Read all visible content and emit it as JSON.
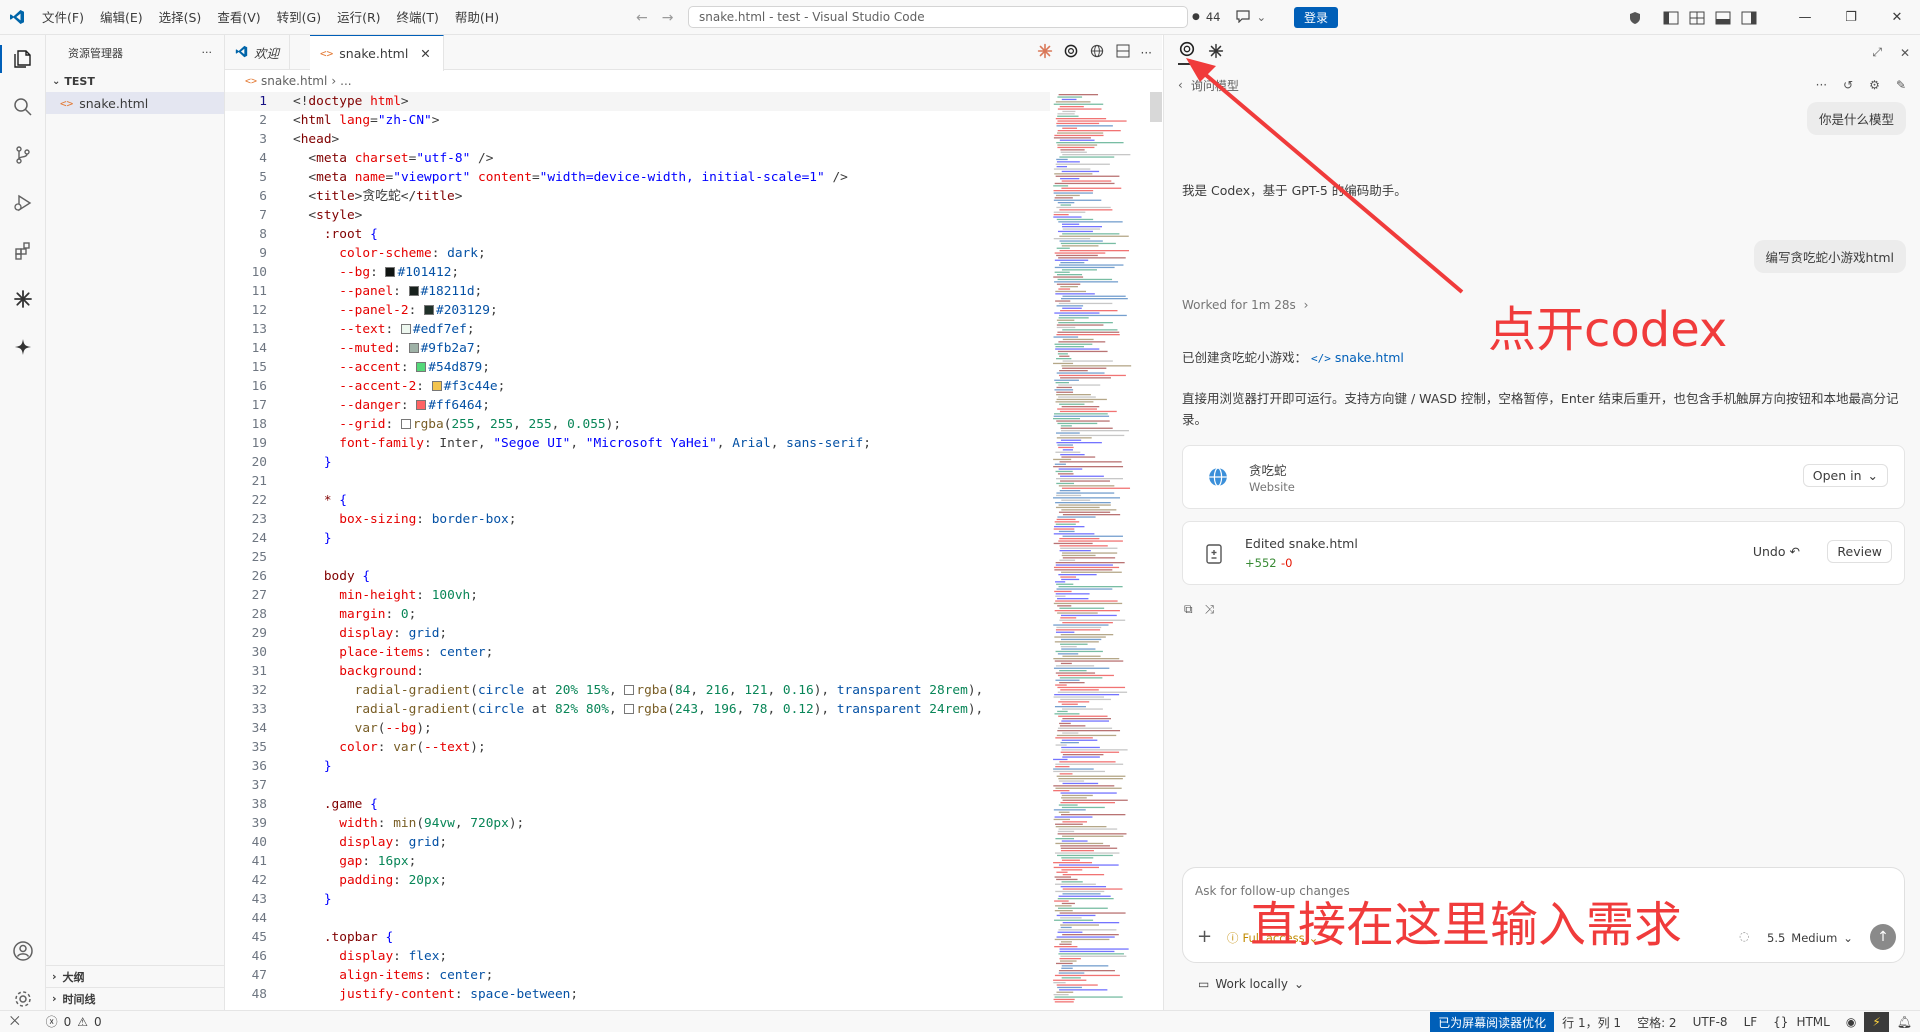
{
  "titlebar": {
    "menu": [
      "文件(F)",
      "编辑(E)",
      "选择(S)",
      "查看(V)",
      "转到(G)",
      "运行(R)",
      "终端(T)",
      "帮助(H)"
    ],
    "window_title": "snake.html - test - Visual Studio Code",
    "count": "44",
    "login_label": "登录",
    "window_buttons": [
      "—",
      "❐",
      "✕"
    ]
  },
  "sidebar": {
    "title": "资源管理器",
    "more": "···",
    "folder": "TEST",
    "file": "snake.html",
    "outline": "大纲",
    "timeline": "时间线"
  },
  "editor": {
    "tabs": [
      {
        "label": "欢迎",
        "active": false
      },
      {
        "label": "snake.html",
        "active": true
      }
    ],
    "breadcrumb": [
      "snake.html",
      "..."
    ],
    "lines": [
      {
        "n": "1",
        "html": "<span class='tok-punc'>&lt;!</span><span class='tok-tag'>doctype</span> <span class='tok-attr'>html</span><span class='tok-punc'>&gt;</span>"
      },
      {
        "n": "2",
        "html": "<span class='tok-punc'>&lt;</span><span class='tok-tag'>html</span> <span class='tok-attr'>lang</span>=<span class='tok-str'>\"zh-CN\"</span><span class='tok-punc'>&gt;</span>"
      },
      {
        "n": "3",
        "html": "<span class='tok-punc'>&lt;</span><span class='tok-tag'>head</span><span class='tok-punc'>&gt;</span>"
      },
      {
        "n": "4",
        "html": "  <span class='tok-punc'>&lt;</span><span class='tok-tag'>meta</span> <span class='tok-attr'>charset</span>=<span class='tok-str'>\"utf-8\"</span> <span class='tok-punc'>/&gt;</span>"
      },
      {
        "n": "5",
        "html": "  <span class='tok-punc'>&lt;</span><span class='tok-tag'>meta</span> <span class='tok-attr'>name</span>=<span class='tok-str'>\"viewport\"</span> <span class='tok-attr'>content</span>=<span class='tok-str'>\"width=device-width, initial-scale=1\"</span> <span class='tok-punc'>/&gt;</span>"
      },
      {
        "n": "6",
        "html": "  <span class='tok-punc'>&lt;</span><span class='tok-tag'>title</span><span class='tok-punc'>&gt;</span>贪吃蛇<span class='tok-punc'>&lt;/</span><span class='tok-tag'>title</span><span class='tok-punc'>&gt;</span>"
      },
      {
        "n": "7",
        "html": "  <span class='tok-punc'>&lt;</span><span class='tok-tag'>style</span><span class='tok-punc'>&gt;</span>"
      },
      {
        "n": "8",
        "html": "    <span class='tok-sel'>:root</span> <span class='tok-kw'>{</span>"
      },
      {
        "n": "9",
        "html": "      <span class='tok-prop'>color-scheme</span>: <span class='tok-val'>dark</span>;"
      },
      {
        "n": "10",
        "html": "      <span class='tok-prop'>--bg</span>: <span class='swatch' style='background:#101412'></span><span class='tok-val'>#101412</span>;"
      },
      {
        "n": "11",
        "html": "      <span class='tok-prop'>--panel</span>: <span class='swatch' style='background:#18211d'></span><span class='tok-val'>#18211d</span>;"
      },
      {
        "n": "12",
        "html": "      <span class='tok-prop'>--panel-2</span>: <span class='swatch' style='background:#203129'></span><span class='tok-val'>#203129</span>;"
      },
      {
        "n": "13",
        "html": "      <span class='tok-prop'>--text</span>: <span class='swatch' style='background:#edf7ef'></span><span class='tok-val'>#edf7ef</span>;"
      },
      {
        "n": "14",
        "html": "      <span class='tok-prop'>--muted</span>: <span class='swatch' style='background:#9fb2a7'></span><span class='tok-val'>#9fb2a7</span>;"
      },
      {
        "n": "15",
        "html": "      <span class='tok-prop'>--accent</span>: <span class='swatch' style='background:#54d879'></span><span class='tok-val'>#54d879</span>;"
      },
      {
        "n": "16",
        "html": "      <span class='tok-prop'>--accent-2</span>: <span class='swatch' style='background:#f3c44e'></span><span class='tok-val'>#f3c44e</span>;"
      },
      {
        "n": "17",
        "html": "      <span class='tok-prop'>--danger</span>: <span class='swatch' style='background:#ff6464'></span><span class='tok-val'>#ff6464</span>;"
      },
      {
        "n": "18",
        "html": "      <span class='tok-prop'>--grid</span>: <span class='swatch' style='background:#ffffff'></span><span class='tok-fn'>rgba</span>(<span class='tok-num'>255</span>, <span class='tok-num'>255</span>, <span class='tok-num'>255</span>, <span class='tok-num'>0.055</span>);"
      },
      {
        "n": "19",
        "html": "      <span class='tok-prop'>font-family</span>: Inter, <span class='tok-str'>\"Segoe UI\"</span>, <span class='tok-str'>\"Microsoft YaHei\"</span>, <span class='tok-val'>Arial</span>, <span class='tok-val'>sans-serif</span>;"
      },
      {
        "n": "20",
        "html": "    <span class='tok-kw'>}</span>"
      },
      {
        "n": "21",
        "html": ""
      },
      {
        "n": "22",
        "html": "    <span class='tok-sel'>*</span> <span class='tok-kw'>{</span>"
      },
      {
        "n": "23",
        "html": "      <span class='tok-prop'>box-sizing</span>: <span class='tok-val'>border-box</span>;"
      },
      {
        "n": "24",
        "html": "    <span class='tok-kw'>}</span>"
      },
      {
        "n": "25",
        "html": ""
      },
      {
        "n": "26",
        "html": "    <span class='tok-sel'>body</span> <span class='tok-kw'>{</span>"
      },
      {
        "n": "27",
        "html": "      <span class='tok-prop'>min-height</span>: <span class='tok-num'>100vh</span>;"
      },
      {
        "n": "28",
        "html": "      <span class='tok-prop'>margin</span>: <span class='tok-num'>0</span>;"
      },
      {
        "n": "29",
        "html": "      <span class='tok-prop'>display</span>: <span class='tok-val'>grid</span>;"
      },
      {
        "n": "30",
        "html": "      <span class='tok-prop'>place-items</span>: <span class='tok-val'>center</span>;"
      },
      {
        "n": "31",
        "html": "      <span class='tok-prop'>background</span>:"
      },
      {
        "n": "32",
        "html": "        <span class='tok-fn'>radial-gradient</span>(<span class='tok-val'>circle</span> at <span class='tok-num'>20%</span> <span class='tok-num'>15%</span>, <span class='swatch' style='background:#fff'></span><span class='tok-fn'>rgba</span>(<span class='tok-num'>84</span>, <span class='tok-num'>216</span>, <span class='tok-num'>121</span>, <span class='tok-num'>0.16</span>), <span class='tok-val'>transparent</span> <span class='tok-num'>28rem</span>),"
      },
      {
        "n": "33",
        "html": "        <span class='tok-fn'>radial-gradient</span>(<span class='tok-val'>circle</span> at <span class='tok-num'>82%</span> <span class='tok-num'>80%</span>, <span class='swatch' style='background:#fff'></span><span class='tok-fn'>rgba</span>(<span class='tok-num'>243</span>, <span class='tok-num'>196</span>, <span class='tok-num'>78</span>, <span class='tok-num'>0.12</span>), <span class='tok-val'>transparent</span> <span class='tok-num'>24rem</span>),"
      },
      {
        "n": "34",
        "html": "        <span class='tok-fn'>var</span>(<span class='tok-prop'>--bg</span>);"
      },
      {
        "n": "35",
        "html": "      <span class='tok-prop'>color</span>: <span class='tok-fn'>var</span>(<span class='tok-prop'>--text</span>);"
      },
      {
        "n": "36",
        "html": "    <span class='tok-kw'>}</span>"
      },
      {
        "n": "37",
        "html": ""
      },
      {
        "n": "38",
        "html": "    <span class='tok-sel'>.game</span> <span class='tok-kw'>{</span>"
      },
      {
        "n": "39",
        "html": "      <span class='tok-prop'>width</span>: <span class='tok-fn'>min</span>(<span class='tok-num'>94vw</span>, <span class='tok-num'>720px</span>);"
      },
      {
        "n": "40",
        "html": "      <span class='tok-prop'>display</span>: <span class='tok-val'>grid</span>;"
      },
      {
        "n": "41",
        "html": "      <span class='tok-prop'>gap</span>: <span class='tok-num'>16px</span>;"
      },
      {
        "n": "42",
        "html": "      <span class='tok-prop'>padding</span>: <span class='tok-num'>20px</span>;"
      },
      {
        "n": "43",
        "html": "    <span class='tok-kw'>}</span>"
      },
      {
        "n": "44",
        "html": ""
      },
      {
        "n": "45",
        "html": "    <span class='tok-sel'>.topbar</span> <span class='tok-kw'>{</span>"
      },
      {
        "n": "46",
        "html": "      <span class='tok-prop'>display</span>: <span class='tok-val'>flex</span>;"
      },
      {
        "n": "47",
        "html": "      <span class='tok-prop'>align-items</span>: <span class='tok-val'>center</span>;"
      },
      {
        "n": "48",
        "html": "      <span class='tok-prop'>justify-content</span>: <span class='tok-val'>space-between</span>;"
      }
    ]
  },
  "codex": {
    "back_label": "询问模型",
    "user_msg_1": "你是什么模型",
    "reply_1": "我是 Codex，基于 GPT-5 的编码助手。",
    "user_msg_2": "编写贪吃蛇小游戏html",
    "worked_for": "Worked for 1m 28s",
    "created_prefix": "已创建贪吃蛇小游戏：",
    "created_link": "snake.html",
    "description": "直接用浏览器打开即可运行。支持方向键 / WASD 控制，空格暂停，Enter 结束后重开，也包含手机触屏方向按钮和本地最高分记录。",
    "site_card": {
      "title": "贪吃蛇",
      "subtitle": "Website",
      "open_in": "Open in"
    },
    "edit_card": {
      "title": "Edited snake.html",
      "added": "+552",
      "removed": "-0",
      "undo": "Undo",
      "review": "Review"
    },
    "input_placeholder": "Ask for follow-up changes",
    "full_access": "Full access",
    "model": "5.5",
    "effort": "Medium",
    "work_locally": "Work locally"
  },
  "annotations": {
    "open_codex": "点开codex",
    "input_here": "直接在这里输入需求"
  },
  "statusbar": {
    "errors": "0",
    "warnings": "0",
    "screen_reader": "已为屏幕阅读器优化",
    "position": "行 1，列 1",
    "spaces": "空格: 2",
    "encoding": "UTF-8",
    "eol": "LF",
    "language": "HTML"
  }
}
